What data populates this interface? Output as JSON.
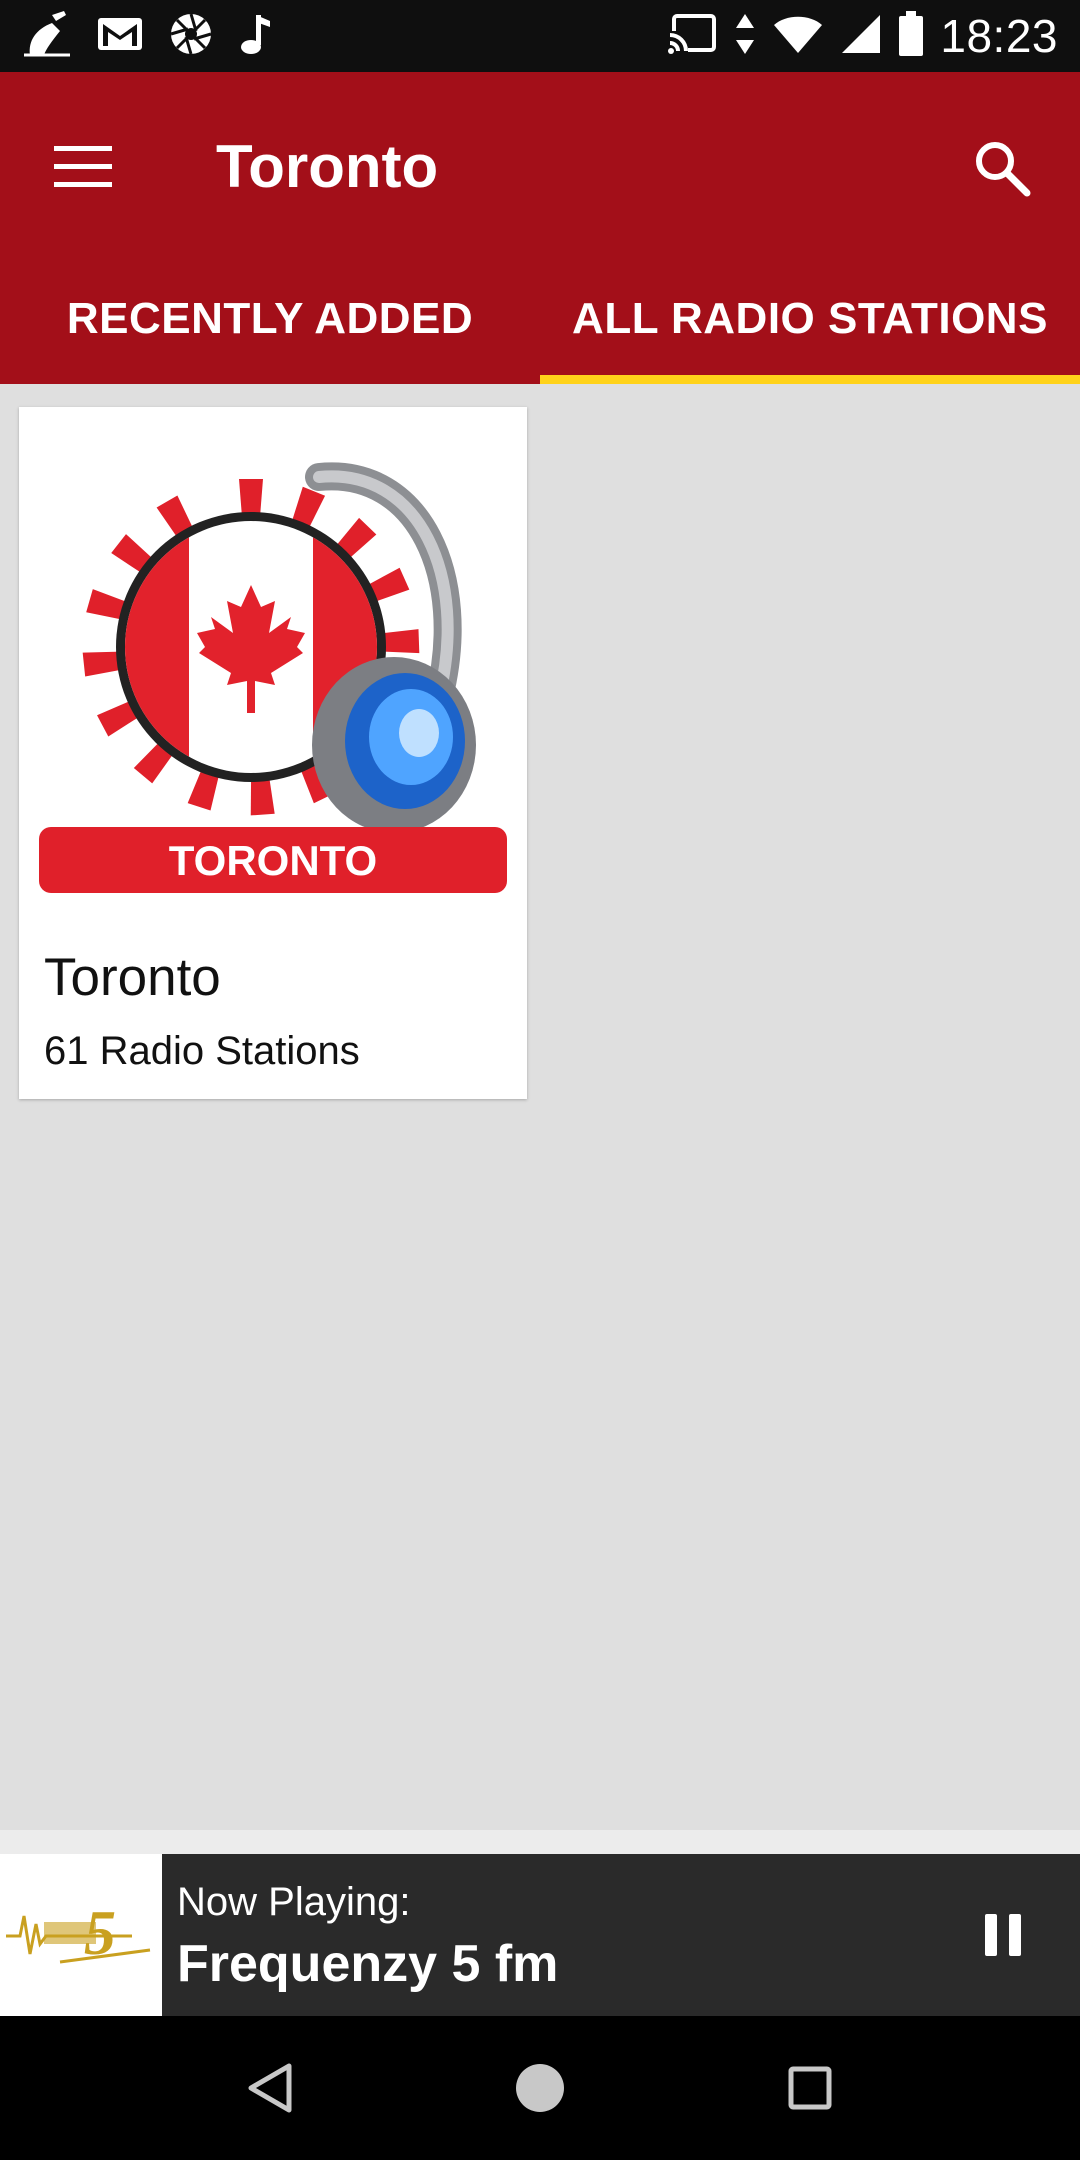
{
  "status_bar": {
    "time": "18:23",
    "left_icons": [
      "broom-icon",
      "gmail-icon",
      "aperture-icon",
      "music-note-icon"
    ],
    "right_icons": [
      "cast-icon",
      "data-arrows-icon",
      "wifi-icon",
      "cell-signal-icon",
      "battery-icon"
    ]
  },
  "app_bar": {
    "title": "Toronto",
    "background": "#a30f19",
    "tabs": [
      {
        "label": "RECENTLY ADDED",
        "selected": false
      },
      {
        "label": "ALL RADIO STATIONS",
        "selected": true
      }
    ],
    "indicator_color": "#ffd21a"
  },
  "cards": [
    {
      "image_badge_text": "TORONTO",
      "title": "Toronto",
      "subtitle": "61 Radio Stations"
    }
  ],
  "now_playing": {
    "label": "Now Playing:",
    "station": "Frequenzy 5 fm",
    "thumb_text": "5"
  }
}
